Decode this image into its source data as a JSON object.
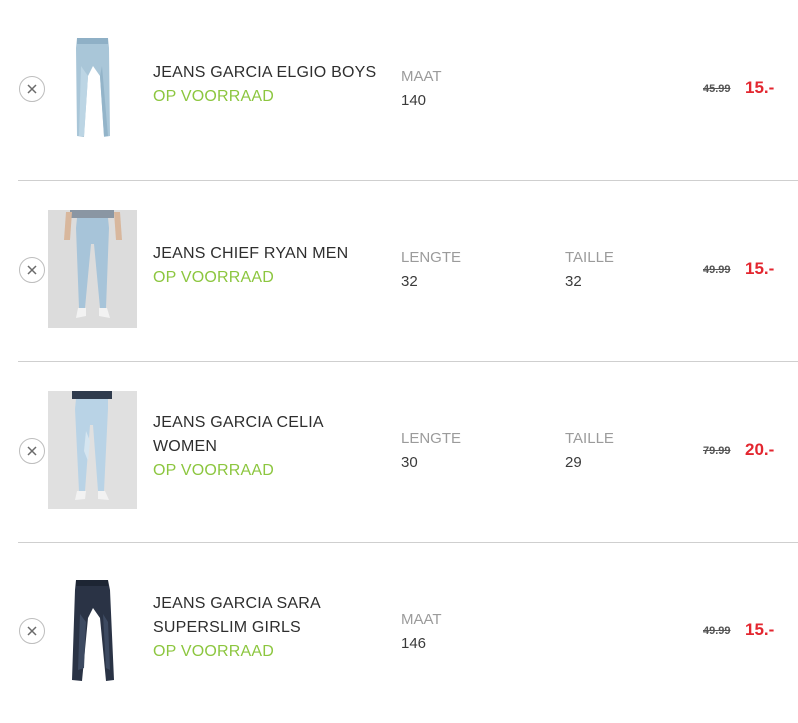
{
  "cart_items": [
    {
      "name_lines": [
        "JEANS GARCIA ELGIO BOYS"
      ],
      "stock": "OP VOORRAAD",
      "attrs": [
        {
          "label": "MAAT",
          "value": "140"
        }
      ],
      "old_price": "45.99",
      "new_price": "15.-",
      "image_style": "product-only-light-wash"
    },
    {
      "name_lines": [
        "JEANS CHIEF RYAN MEN"
      ],
      "stock": "OP VOORRAAD",
      "attrs": [
        {
          "label": "LENGTE",
          "value": "32"
        },
        {
          "label": "TAILLE",
          "value": "32"
        }
      ],
      "old_price": "49.99",
      "new_price": "15.-",
      "image_style": "model-light-wash"
    },
    {
      "name_lines": [
        "JEANS GARCIA CELIA",
        "WOMEN"
      ],
      "stock": "OP VOORRAAD",
      "attrs": [
        {
          "label": "LENGTE",
          "value": "30"
        },
        {
          "label": "TAILLE",
          "value": "29"
        }
      ],
      "old_price": "79.99",
      "new_price": "20.-",
      "image_style": "model-light-wash"
    },
    {
      "name_lines": [
        "JEANS GARCIA SARA",
        "SUPERSLIM GIRLS"
      ],
      "stock": "OP VOORRAAD",
      "attrs": [
        {
          "label": "MAAT",
          "value": "146"
        }
      ],
      "old_price": "49.99",
      "new_price": "15.-",
      "image_style": "product-only-dark-wash"
    }
  ],
  "colors": {
    "stock_green": "#8cc63f",
    "sale_red": "#e3262f",
    "label_gray": "#9b9b9b",
    "divider": "#cfcfcf"
  },
  "icons": {
    "remove": "close-circle-icon"
  }
}
